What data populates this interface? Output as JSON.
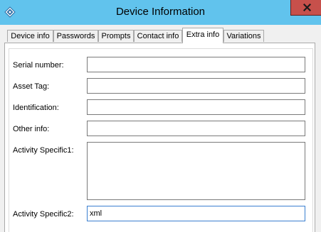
{
  "window": {
    "title": "Device Information",
    "close_label": "close"
  },
  "tabs": [
    {
      "label": "Device info",
      "active": false
    },
    {
      "label": "Passwords",
      "active": false
    },
    {
      "label": "Prompts",
      "active": false
    },
    {
      "label": "Contact info",
      "active": false
    },
    {
      "label": "Extra info",
      "active": true
    },
    {
      "label": "Variations",
      "active": false
    }
  ],
  "fields": {
    "serial_number": {
      "label": "Serial number:",
      "value": ""
    },
    "asset_tag": {
      "label": "Asset Tag:",
      "value": ""
    },
    "identification": {
      "label": "Identification:",
      "value": ""
    },
    "other_info": {
      "label": "Other info:",
      "value": ""
    },
    "activity_specific1": {
      "label": "Activity Specific1:",
      "value": ""
    },
    "activity_specific2": {
      "label": "Activity Specific2:",
      "value": "xml"
    }
  },
  "colors": {
    "titlebar": "#61c3ed",
    "close_button": "#c7504b",
    "focus_border": "#3a7fd0"
  },
  "icons": {
    "app": "device-app-icon",
    "close": "close-icon"
  }
}
